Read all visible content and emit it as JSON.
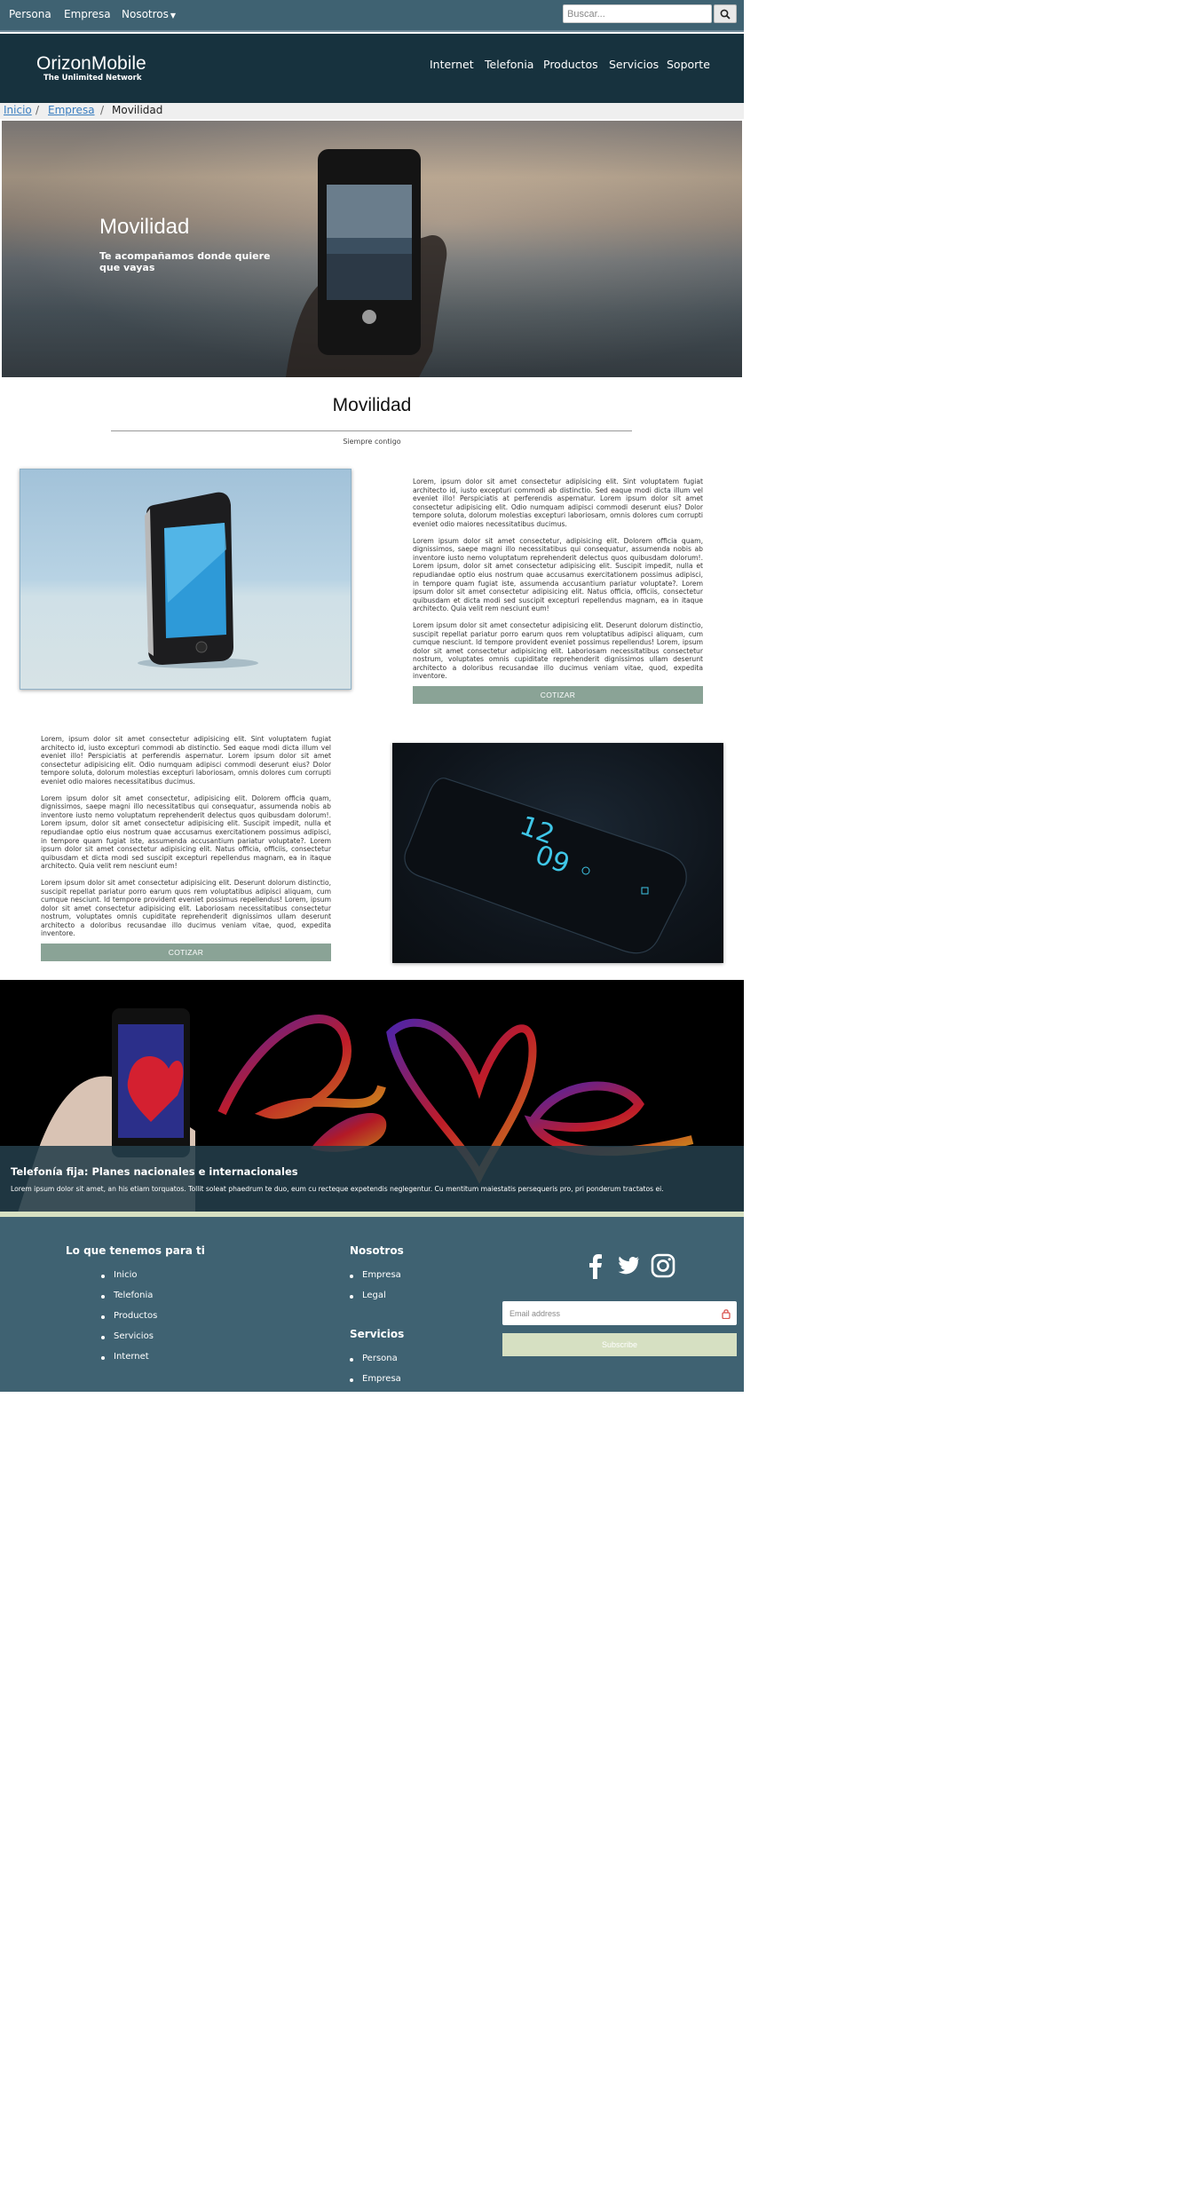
{
  "topbar": {
    "links": [
      "Persona",
      "Empresa",
      "Nosotros"
    ],
    "search_placeholder": "Buscar..."
  },
  "header": {
    "brand": "OrizonMobile",
    "tagline": "The Unlimited Network",
    "nav": [
      "Internet",
      "Telefonia",
      "Productos",
      "Servicios",
      "Soporte"
    ]
  },
  "breadcrumb": {
    "items": [
      "Inicio",
      "Empresa",
      "Movilidad"
    ]
  },
  "hero": {
    "title": "Movilidad",
    "subtitle": "Te acompañamos donde quiere que vayas"
  },
  "section": {
    "title": "Movilidad",
    "subtitle": "Siempre contigo"
  },
  "features": [
    {
      "paragraphs": [
        "Lorem, ipsum dolor sit amet consectetur adipisicing elit. Sint voluptatem fugiat architecto id, iusto excepturi commodi ab distinctio. Sed eaque modi dicta illum vel eveniet illo! Perspiciatis at perferendis aspernatur. Lorem ipsum dolor sit amet consectetur adipisicing elit. Odio numquam adipisci commodi deserunt eius? Dolor tempore soluta, dolorum molestias excepturi laboriosam, omnis dolores cum corrupti eveniet odio maiores necessitatibus ducimus.",
        "Lorem ipsum dolor sit amet consectetur, adipisicing elit. Dolorem officia quam, dignissimos, saepe magni illo necessitatibus qui consequatur, assumenda nobis ab inventore iusto nemo voluptatum reprehenderit delectus quos quibusdam dolorum!. Lorem ipsum, dolor sit amet consectetur adipisicing elit. Suscipit impedit, nulla et repudiandae optio eius nostrum quae accusamus exercitationem possimus adipisci, in tempore quam fugiat iste, assumenda accusantium pariatur voluptate?. Lorem ipsum dolor sit amet consectetur adipisicing elit. Natus officia, officiis, consectetur quibusdam et dicta modi sed suscipit excepturi repellendus magnam, ea in itaque architecto. Quia velit rem nesciunt eum!",
        "Lorem ipsum dolor sit amet consectetur adipisicing elit. Deserunt dolorum distinctio, suscipit repellat pariatur porro earum quos rem voluptatibus adipisci aliquam, cum cumque nesciunt. Id tempore provident eveniet possimus repellendus! Lorem, ipsum dolor sit amet consectetur adipisicing elit. Laboriosam necessitatibus consectetur nostrum, voluptates omnis cupiditate reprehenderit dignissimos ullam deserunt architecto a doloribus recusandae illo ducimus veniam vitae, quod, expedita inventore."
      ],
      "button": "COTIZAR"
    },
    {
      "paragraphs": [
        "Lorem, ipsum dolor sit amet consectetur adipisicing elit. Sint voluptatem fugiat architecto id, iusto excepturi commodi ab distinctio. Sed eaque modi dicta illum vel eveniet illo! Perspiciatis at perferendis aspernatur. Lorem ipsum dolor sit amet consectetur adipisicing elit. Odio numquam adipisci commodi deserunt eius? Dolor tempore soluta, dolorum molestias excepturi laboriosam, omnis dolores cum corrupti eveniet odio maiores necessitatibus ducimus.",
        "Lorem ipsum dolor sit amet consectetur, adipisicing elit. Dolorem officia quam, dignissimos, saepe magni illo necessitatibus qui consequatur, assumenda nobis ab inventore iusto nemo voluptatum reprehenderit delectus quos quibusdam dolorum!. Lorem ipsum, dolor sit amet consectetur adipisicing elit. Suscipit impedit, nulla et repudiandae optio eius nostrum quae accusamus exercitationem possimus adipisci, in tempore quam fugiat iste, assumenda accusantium pariatur voluptate?. Lorem ipsum dolor sit amet consectetur adipisicing elit. Natus officia, officiis, consectetur quibusdam et dicta modi sed suscipit excepturi repellendus magnam, ea in itaque architecto. Quia velit rem nesciunt eum!",
        "Lorem ipsum dolor sit amet consectetur adipisicing elit. Deserunt dolorum distinctio, suscipit repellat pariatur porro earum quos rem voluptatibus adipisci aliquam, cum cumque nesciunt. Id tempore provident eveniet possimus repellendus! Lorem, ipsum dolor sit amet consectetur adipisicing elit. Laboriosam necessitatibus consectetur nostrum, voluptates omnis cupiditate reprehenderit dignissimos ullam deserunt architecto a doloribus recusandae illo ducimus veniam vitae, quod, expedita inventore."
      ],
      "button": "COTIZAR"
    }
  ],
  "banner": {
    "title": "Telefonía fija: Planes nacionales e internacionales",
    "text": "Lorem ipsum dolor sit amet, an his etiam torquatos. Tollit soleat phaedrum te duo, eum cu recteque expetendis neglegentur. Cu mentitum maiestatis persequeris pro, pri ponderum tractatos ei."
  },
  "phone_screen": {
    "time_hour": "12",
    "time_min": "09"
  },
  "footer": {
    "col1": {
      "title": "Lo que tenemos para ti",
      "items": [
        "Inicio",
        "Telefonia",
        "Productos",
        "Servicios",
        "Internet"
      ]
    },
    "col2": {
      "title": "Nosotros",
      "items": [
        "Empresa",
        "Legal"
      ]
    },
    "col3": {
      "title": "Servicios",
      "items": [
        "Persona",
        "Empresa"
      ]
    },
    "email_placeholder": "Email address",
    "subscribe": "Subscribe",
    "social": [
      "facebook-icon",
      "twitter-icon",
      "instagram-icon"
    ]
  },
  "colors": {
    "topbar": "#3f6272",
    "header": "#17323e",
    "button": "#8aa396",
    "accent_light": "#d6e0c2"
  }
}
